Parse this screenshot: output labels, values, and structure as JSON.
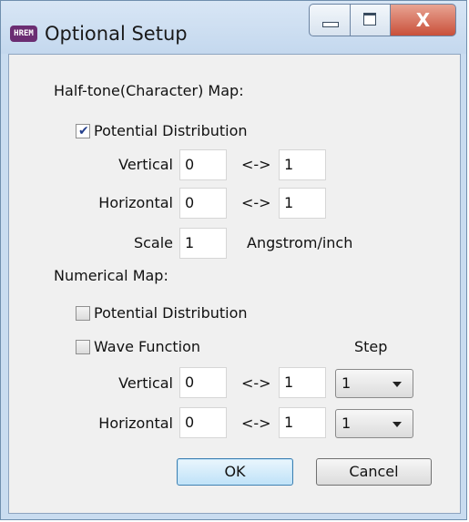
{
  "window": {
    "title": "Optional Setup",
    "app_icon_text": "HREM",
    "controls": {
      "minimize": "minimize",
      "maximize": "maximize",
      "close": "X"
    }
  },
  "halftone": {
    "section_label": "Half-tone(Character) Map:",
    "potential_distribution": {
      "label": "Potential Distribution",
      "checked": true
    },
    "vertical": {
      "label": "Vertical",
      "from": "0",
      "arrow": "<->",
      "to": "1"
    },
    "horizontal": {
      "label": "Horizontal",
      "from": "0",
      "arrow": "<->",
      "to": "1"
    },
    "scale": {
      "label": "Scale",
      "value": "1",
      "unit": "Angstrom/inch"
    }
  },
  "numerical": {
    "section_label": "Numerical Map:",
    "potential_distribution": {
      "label": "Potential Distribution",
      "checked": false
    },
    "wave_function": {
      "label": "Wave Function",
      "checked": false
    },
    "step_label": "Step",
    "vertical": {
      "label": "Vertical",
      "from": "0",
      "arrow": "<->",
      "to": "1",
      "step": "1"
    },
    "horizontal": {
      "label": "Horizontal",
      "from": "0",
      "arrow": "<->",
      "to": "1",
      "step": "1"
    }
  },
  "buttons": {
    "ok": "OK",
    "cancel": "Cancel"
  },
  "colors": {
    "titlebar": "#c9dcf0",
    "client": "#f0f0f0",
    "close_button": "#c9503a",
    "checkmark": "#243f8c"
  }
}
